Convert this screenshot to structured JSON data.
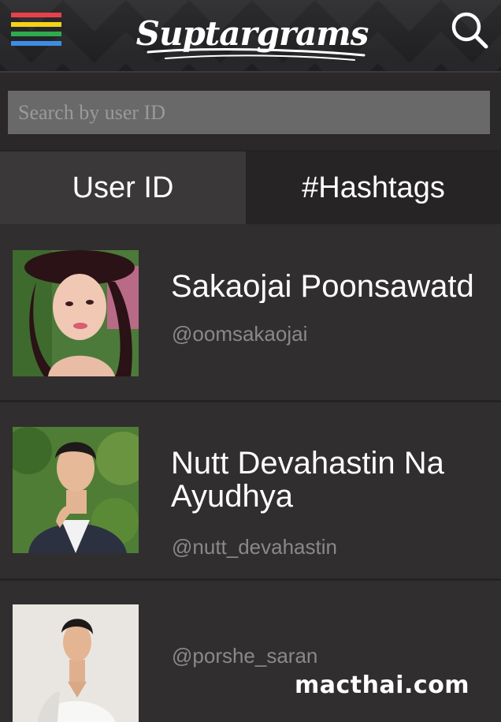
{
  "header": {
    "brand": "Suptargrams",
    "menu_icon": "hamburger-menu-icon",
    "search_icon": "search-icon",
    "menu_colors": [
      "#e8414b",
      "#f5d316",
      "#2faa4f",
      "#3d8de3"
    ]
  },
  "search": {
    "placeholder": "Search by user ID",
    "value": ""
  },
  "tabs": [
    {
      "label": "User ID",
      "active": true
    },
    {
      "label": "#Hashtags",
      "active": false
    }
  ],
  "users": [
    {
      "name": "Sakaojai Poonsawatd",
      "handle": "@oomsakaojai"
    },
    {
      "name": "Nutt Devahastin Na Ayudhya",
      "handle": "@nutt_devahastin"
    },
    {
      "name": "",
      "handle": "@porshe_saran"
    }
  ],
  "watermark": "macthai.com"
}
